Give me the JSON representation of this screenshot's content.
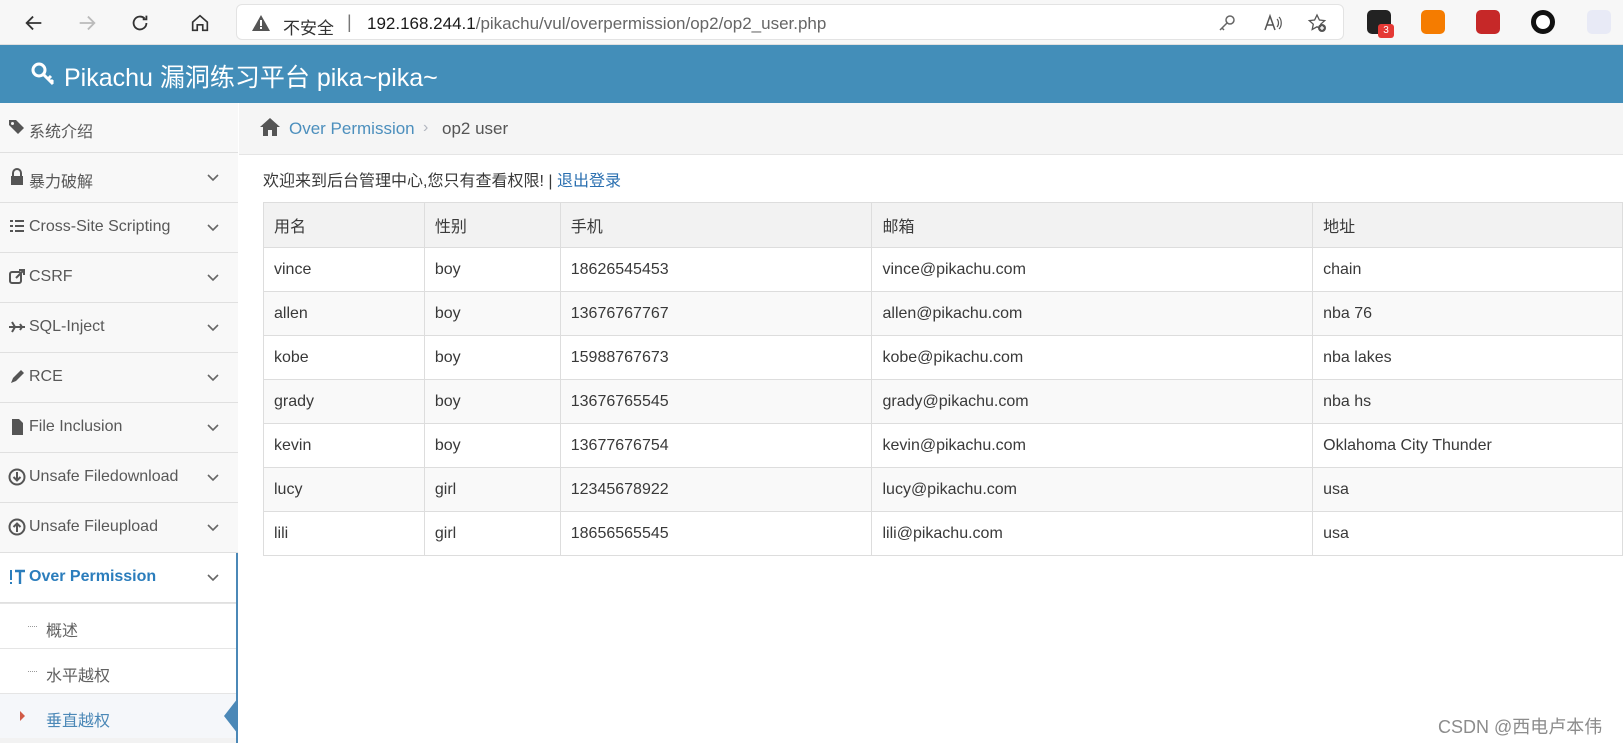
{
  "browser": {
    "insecure_label": "不安全",
    "separator": "|",
    "url_host": "192.168.244.1",
    "url_path": "/pikachu/vul/overpermission/op2/op2_user.php",
    "ext_badge": "3"
  },
  "app": {
    "title": "Pikachu 漏洞练习平台 pika~pika~"
  },
  "sidebar": {
    "items": [
      {
        "label": "系统介绍",
        "icon": "tags-icon"
      },
      {
        "label": "暴力破解",
        "icon": "lock-icon"
      },
      {
        "label": "Cross-Site Scripting",
        "icon": "list-indent-icon"
      },
      {
        "label": "CSRF",
        "icon": "share-square-icon"
      },
      {
        "label": "SQL-Inject",
        "icon": "plane-icon"
      },
      {
        "label": "RCE",
        "icon": "pencil-icon"
      },
      {
        "label": "File Inclusion",
        "icon": "file-icon"
      },
      {
        "label": "Unsafe Filedownload",
        "icon": "download-circle-icon"
      },
      {
        "label": "Unsafe Fileupload",
        "icon": "upload-circle-icon"
      },
      {
        "label": "Over Permission",
        "icon": "text-height-icon"
      }
    ],
    "subitems": [
      {
        "label": "概述"
      },
      {
        "label": "水平越权"
      },
      {
        "label": "垂直越权"
      }
    ]
  },
  "breadcrumb": {
    "link": "Over Permission",
    "separator": "›",
    "current": "op2 user"
  },
  "welcome": {
    "text": "欢迎来到后台管理中心,您只有查看权限!",
    "divider": "|",
    "logout": "退出登录"
  },
  "table": {
    "headers": [
      "用名",
      "性别",
      "手机",
      "邮箱",
      "地址"
    ],
    "rows": [
      [
        "vince",
        "boy",
        "18626545453",
        "vince@pikachu.com",
        "chain"
      ],
      [
        "allen",
        "boy",
        "13676767767",
        "allen@pikachu.com",
        "nba 76"
      ],
      [
        "kobe",
        "boy",
        "15988767673",
        "kobe@pikachu.com",
        "nba lakes"
      ],
      [
        "grady",
        "boy",
        "13676765545",
        "grady@pikachu.com",
        "nba hs"
      ],
      [
        "kevin",
        "boy",
        "13677676754",
        "kevin@pikachu.com",
        "Oklahoma City Thunder"
      ],
      [
        "lucy",
        "girl",
        "12345678922",
        "lucy@pikachu.com",
        "usa"
      ],
      [
        "lili",
        "girl",
        "18656565545",
        "lili@pikachu.com",
        "usa"
      ]
    ]
  },
  "watermark": "CSDN @西电卢本伟",
  "colors": {
    "header_bg": "#438eb9",
    "link": "#4c8fbd",
    "active": "#2b7dbc"
  }
}
